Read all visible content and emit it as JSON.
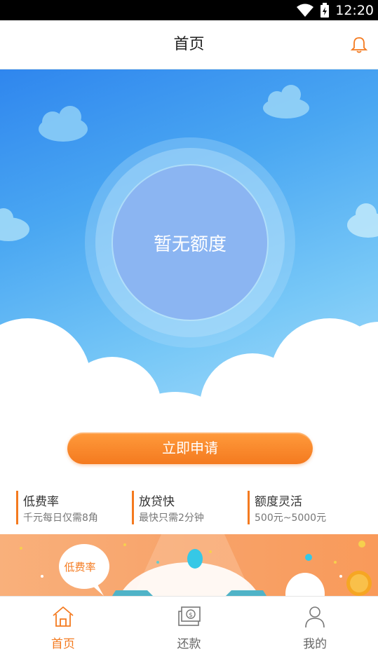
{
  "status_bar": {
    "time": "12:20"
  },
  "header": {
    "title": "首页"
  },
  "hero": {
    "quota_text": "暂无额度"
  },
  "apply_button": {
    "label": "立即申请"
  },
  "features": [
    {
      "title": "低费率",
      "subtitle": "千元每日仅需8角"
    },
    {
      "title": "放贷快",
      "subtitle": "最快只需2分钟"
    },
    {
      "title": "额度灵活",
      "subtitle": "500元~5000元"
    }
  ],
  "banner": {
    "bubble_text": "低费率"
  },
  "tabs": [
    {
      "label": "首页",
      "icon": "home-icon",
      "active": true
    },
    {
      "label": "还款",
      "icon": "repayment-icon",
      "active": false
    },
    {
      "label": "我的",
      "icon": "user-icon",
      "active": false
    }
  ],
  "colors": {
    "accent": "#f47a1f",
    "sky": "#4aa7f2"
  }
}
